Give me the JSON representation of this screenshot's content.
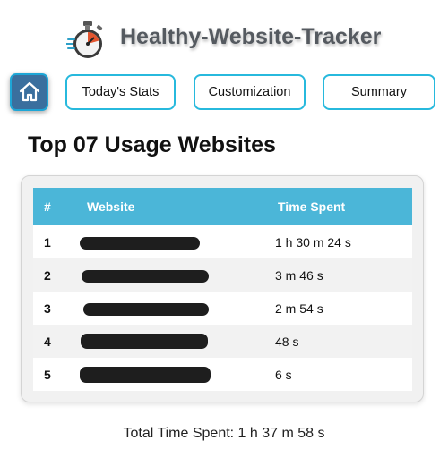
{
  "header": {
    "app_title": "Healthy-Website-Tracker",
    "logo_icon": "stopwatch-icon"
  },
  "nav": {
    "home_icon": "home-icon",
    "buttons": [
      {
        "label": "Today's Stats"
      },
      {
        "label": "Customization"
      },
      {
        "label": "Summary"
      }
    ]
  },
  "section": {
    "title": "Top 07 Usage Websites"
  },
  "table": {
    "columns": [
      "#",
      "Website",
      "Time Spent"
    ],
    "rows": [
      {
        "rank": "1",
        "website": "",
        "time": "1 h 30 m 24 s"
      },
      {
        "rank": "2",
        "website": "",
        "time": "3 m 46 s"
      },
      {
        "rank": "3",
        "website": "",
        "time": "2 m 54 s"
      },
      {
        "rank": "4",
        "website": "",
        "time": "48 s"
      },
      {
        "rank": "5",
        "website": "",
        "time": "6 s"
      }
    ]
  },
  "footer": {
    "total": "Total Time Spent: 1 h 37 m 58 s"
  },
  "colors": {
    "accent": "#27b9dd",
    "table_header": "#4bb6d8",
    "home_button": "#3a6f9e",
    "title_text": "#555a60"
  }
}
